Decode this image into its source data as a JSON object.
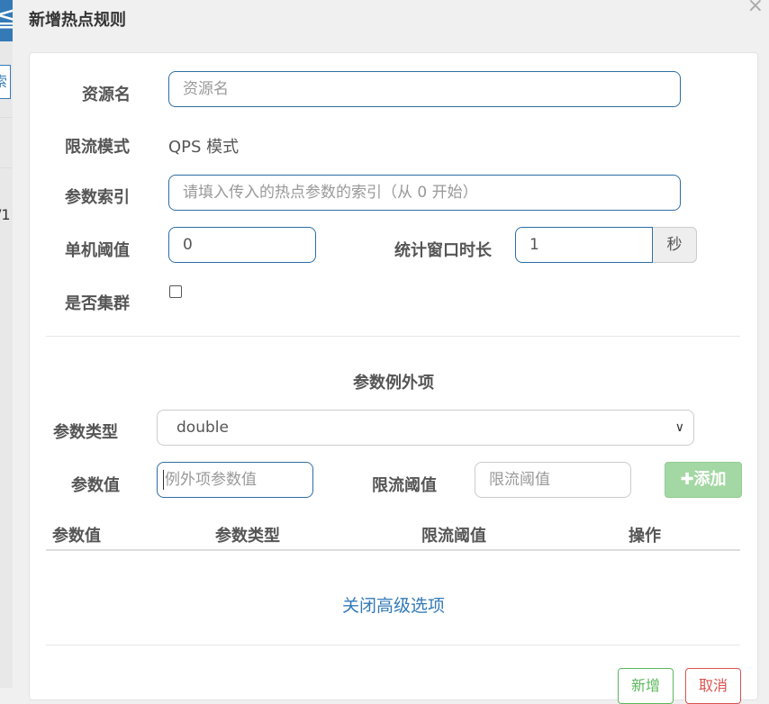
{
  "background": {
    "top_glyph": "≦",
    "search_glyph": "索",
    "row_text": "/1"
  },
  "dialog": {
    "title": "新增热点规则",
    "close": "×"
  },
  "form": {
    "resource": {
      "label": "资源名",
      "placeholder": "资源名"
    },
    "mode": {
      "label": "限流模式",
      "value": "QPS 模式"
    },
    "param_index": {
      "label": "参数索引",
      "placeholder": "请填入传入的热点参数的索引（从 0 开始）"
    },
    "threshold": {
      "label": "单机阈值",
      "value": "0"
    },
    "window": {
      "label": "统计窗口时长",
      "value": "1",
      "unit": "秒"
    },
    "cluster": {
      "label": "是否集群",
      "checked": false
    }
  },
  "exceptions": {
    "title": "参数例外项",
    "param_type": {
      "label": "参数类型",
      "selected": "double"
    },
    "param_value": {
      "label": "参数值",
      "placeholder": "例外项参数值"
    },
    "limit": {
      "label": "限流阈值",
      "placeholder": "限流阈值"
    },
    "add_button": {
      "icon": "plus-icon",
      "label": "添加"
    },
    "table_headers": [
      "参数值",
      "参数类型",
      "限流阈值",
      "操作"
    ]
  },
  "advanced_link": "关闭高级选项",
  "footer": {
    "save": "新增",
    "cancel": "取消"
  },
  "colors": {
    "primary": "#337ab7",
    "success_disabled": "#a3d7a3",
    "danger": "#d9534f",
    "success": "#5cb85c"
  }
}
